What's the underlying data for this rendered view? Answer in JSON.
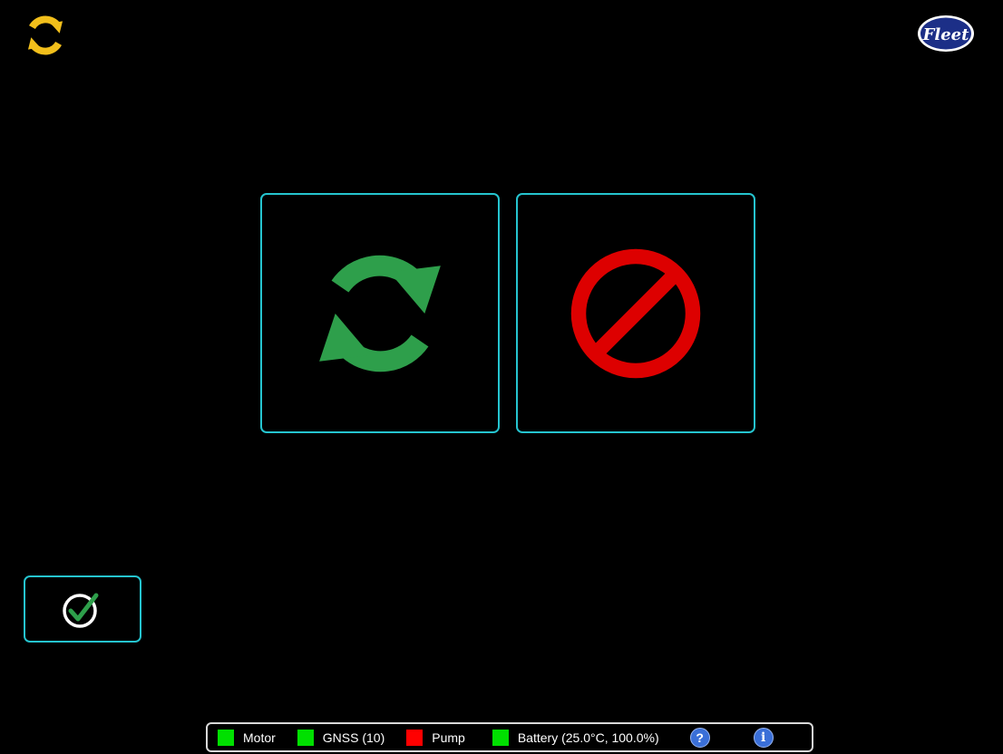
{
  "brand": {
    "logo_text": "Fleet"
  },
  "header": {
    "refresh_icon": "sync-icon",
    "refresh_color": "#f2bf1b"
  },
  "actions": {
    "start": {
      "icon": "sync-icon",
      "color": "#2e9f4b"
    },
    "stop": {
      "icon": "prohibited-icon",
      "color": "#dd0000"
    }
  },
  "confirm": {
    "icon": "check-circle-icon",
    "ring_color": "#ffffff",
    "check_color": "#2e9f4b"
  },
  "accent_color": "#25c4cf",
  "status": {
    "items": [
      {
        "label": "Motor",
        "color": "#00e000"
      },
      {
        "label": "GNSS (10)",
        "color": "#00e000"
      },
      {
        "label": "Pump",
        "color": "#ff0000"
      },
      {
        "label": "Battery (25.0°C, 100.0%)",
        "color": "#00e000"
      }
    ],
    "help_glyph": "?",
    "info_glyph": "i",
    "help_color": "#3a6fd8",
    "info_color": "#3a6fd8"
  }
}
